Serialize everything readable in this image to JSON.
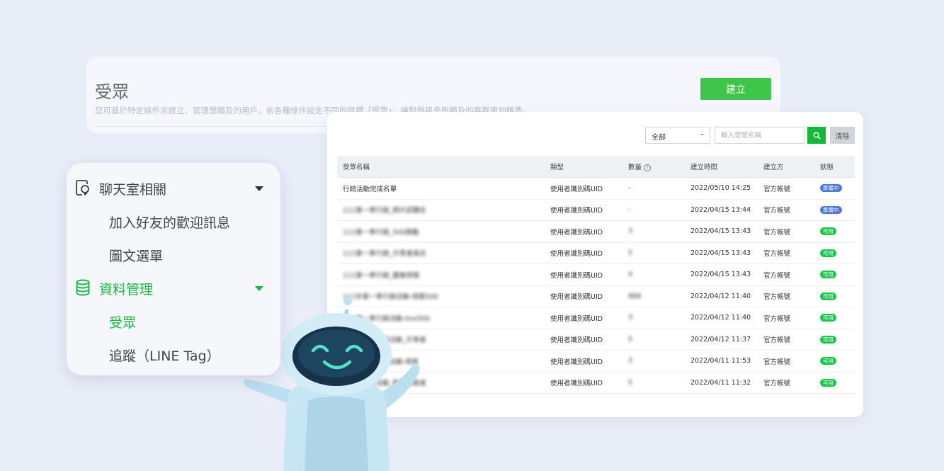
{
  "header": {
    "title": "受眾",
    "description": "您可基於特定條件來建立、管理想觸及的用戶。依各種條件設定不同的目標「受眾」，讓對發訊息所觸及的客群更加精準。",
    "create_label": "建立"
  },
  "filter": {
    "select_value": "全部",
    "search_placeholder": "輸入受眾名稱",
    "clear_label": "清除"
  },
  "table": {
    "columns": [
      "受眾名稱",
      "類型",
      "數量",
      "建立時間",
      "建立方",
      "狀態"
    ],
    "rows": [
      {
        "name": "行銷活動完成名單",
        "type": "使用者識別碼UID",
        "count": "-",
        "created": "2022/05/10 14:25",
        "creator": "官方帳號",
        "status": "準備中"
      },
      {
        "name": "111第一季行銷_照片認購名",
        "type": "使用者識別碼UID",
        "count": "-",
        "created": "2022/04/15 13:44",
        "creator": "官方帳號",
        "status": "準備中"
      },
      {
        "name": "111第一季行銷_500獎勵",
        "type": "使用者識別碼UID",
        "count": "3",
        "created": "2022/04/15 13:43",
        "creator": "官方帳號",
        "status": "可用"
      },
      {
        "name": "111第一季行銷_升等會員名",
        "type": "使用者識別碼UID",
        "count": "5",
        "created": "2022/04/15 13:43",
        "creator": "官方帳號",
        "status": "可用"
      },
      {
        "name": "111第一季行銷_圖像得獎",
        "type": "使用者識別碼UID",
        "count": "4",
        "created": "2022/04/15 13:43",
        "creator": "官方帳號",
        "status": "可用"
      },
      {
        "name": "111年第一季行銷活動-得獎500",
        "type": "使用者識別碼UID",
        "count": "888",
        "created": "2022/04/12 11:40",
        "creator": "官方帳號",
        "status": "可用"
      },
      {
        "name": "111第一季行銷活動-line500",
        "type": "使用者識別碼UID",
        "count": "3",
        "created": "2022/04/12 11:40",
        "creator": "官方帳號",
        "status": "可用"
      },
      {
        "name": "111第一季行銷活動_升等者",
        "type": "使用者識別碼UID",
        "count": "5",
        "created": "2022/04/12 11:37",
        "creator": "官方帳號",
        "status": "可用"
      },
      {
        "name": "111第一季行銷活動-得獎",
        "type": "使用者識別碼UID",
        "count": "3",
        "created": "2022/04/11 11:53",
        "creator": "官方帳號",
        "status": "可用"
      },
      {
        "name": "111第一季活動_歡迎得獎者",
        "type": "使用者識別碼UID",
        "count": "5",
        "created": "2022/04/11 11:32",
        "creator": "官方帳號",
        "status": "可用"
      }
    ]
  },
  "menu": {
    "group1": {
      "label": "聊天室相關",
      "icon": "chat-room-icon"
    },
    "group1_items": [
      "加入好友的歡迎訊息",
      "圖文選單"
    ],
    "group2": {
      "label": "資料管理",
      "icon": "database-icon"
    },
    "group2_items": [
      "受眾",
      "追蹤（LINE Tag）"
    ]
  },
  "colors": {
    "accent_green": "#3fc54a",
    "search_green": "#11b83b",
    "badge_prep": "#4f77d6",
    "badge_ok": "#1ec34c",
    "menu_active": "#1db446",
    "background": "#e9edf8"
  }
}
